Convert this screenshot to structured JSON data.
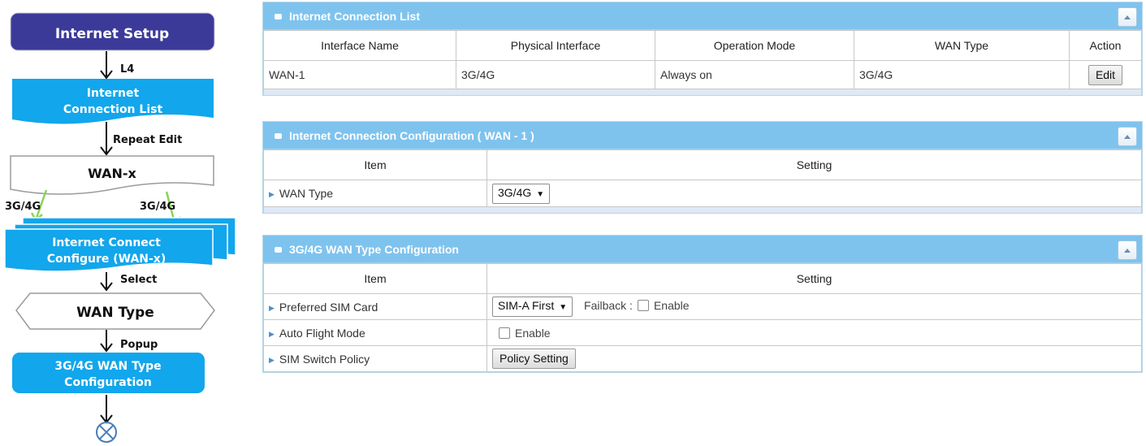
{
  "flow": {
    "internet_setup": "Internet Setup",
    "label_l4": "L4",
    "icl_line1": "Internet",
    "icl_line2": "Connection List",
    "label_repeat": "Repeat Edit",
    "wanx": "WAN-x",
    "label_3g_left": "3G/4G",
    "label_3g_right": "3G/4G",
    "icc_line1": "Internet Connect",
    "icc_line2": "Configure (WAN-x)",
    "label_select": "Select",
    "wan_type": "WAN Type",
    "label_popup": "Popup",
    "cfg_line1": "3G/4G WAN Type",
    "cfg_line2": "Configuration"
  },
  "list_panel": {
    "title": "Internet Connection List",
    "headers": [
      "Interface Name",
      "Physical Interface",
      "Operation Mode",
      "WAN Type",
      "Action"
    ],
    "row": {
      "interface": "WAN-1",
      "physical": "3G/4G",
      "mode": "Always on",
      "wan_type": "3G/4G",
      "action": "Edit"
    }
  },
  "config_panel": {
    "title": "Internet Connection Configuration ( WAN - 1 )",
    "col_item": "Item",
    "col_setting": "Setting",
    "wan_type_label": "WAN Type",
    "wan_type_value": "3G/4G"
  },
  "type_panel": {
    "title": "3G/4G WAN Type Configuration",
    "col_item": "Item",
    "col_setting": "Setting",
    "sim_label": "Preferred SIM Card",
    "sim_value": "SIM-A First",
    "failback_label": "Failback :",
    "failback_enable": "Enable",
    "flight_label": "Auto Flight Mode",
    "flight_enable": "Enable",
    "switch_label": "SIM Switch Policy",
    "switch_button": "Policy Setting"
  },
  "colors": {
    "panel_header": "#7ec3ee",
    "flow_dark": "#3c3a99",
    "flow_cyan": "#12a6ec",
    "flow_arrow_green": "#8ad35a"
  }
}
